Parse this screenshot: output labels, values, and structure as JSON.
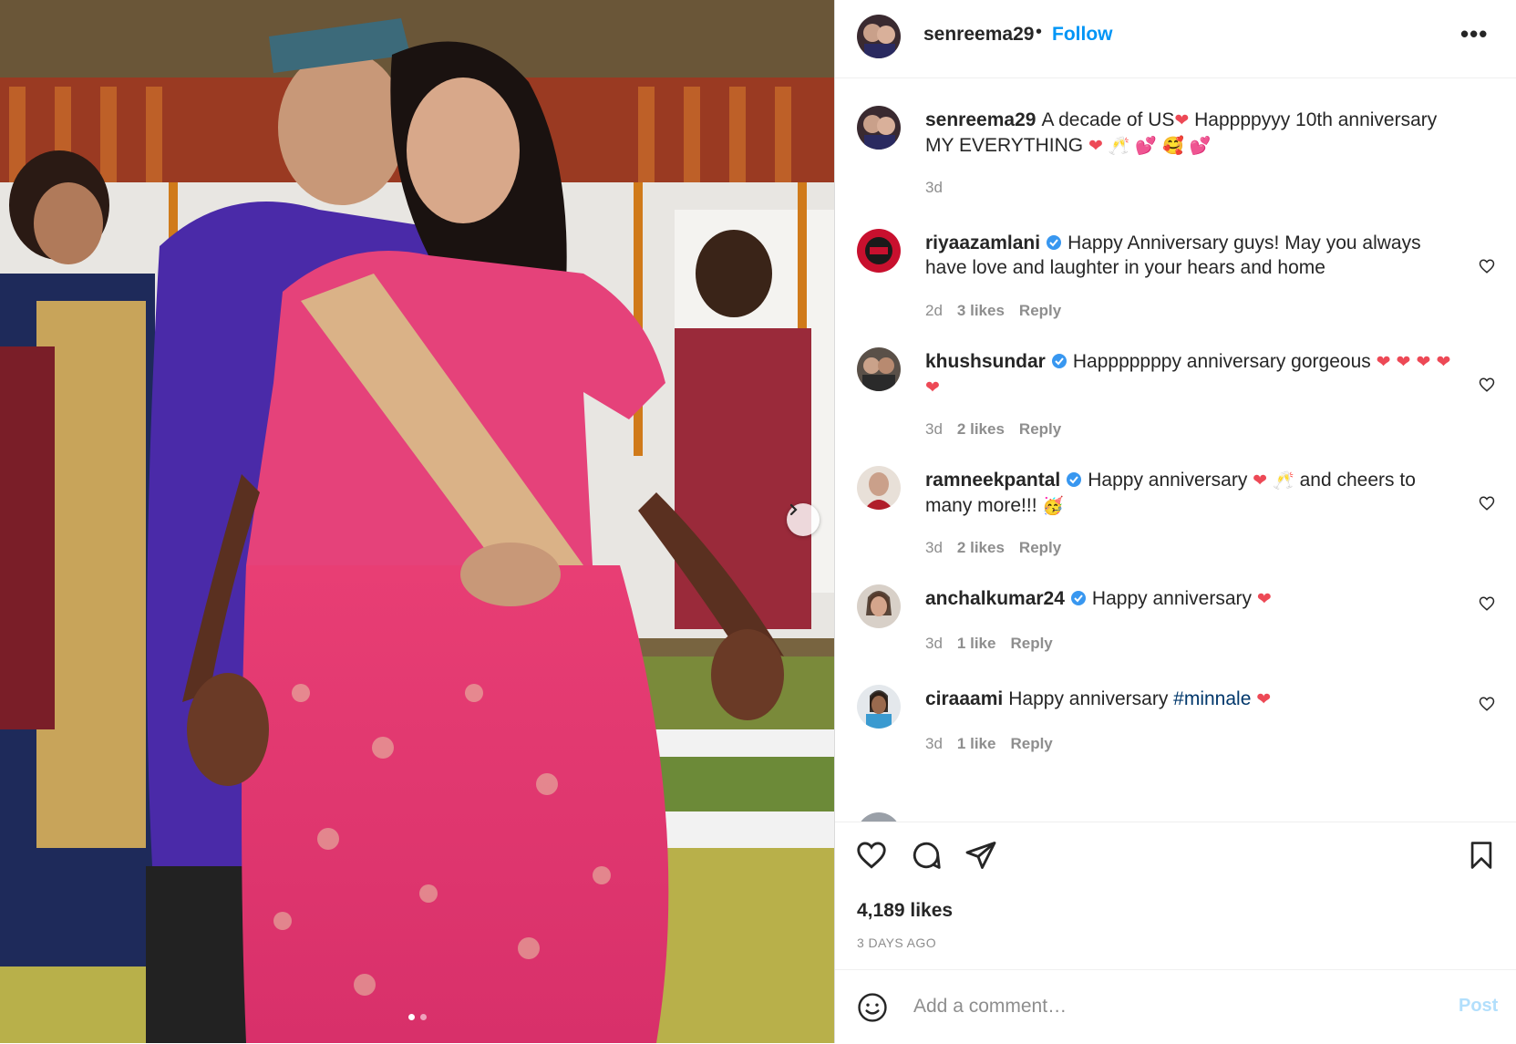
{
  "post": {
    "username": "senreema29",
    "follow_label": "Follow",
    "separator": "•",
    "more_label": "•••"
  },
  "caption": {
    "username": "senreema29",
    "text_a": "A decade of US",
    "text_b": " Happppyyy 10th anniversary MY EVERYTHING ",
    "emoji_heart": "❤",
    "emoji_rest": "🥂 💕 🥰 💕",
    "time": "3d"
  },
  "comments": [
    {
      "username": "riyaazamlani",
      "verified": true,
      "text": "Happy Anniversary guys! May you always have love and laughter in your hears and home",
      "emoji": "",
      "time": "2d",
      "likes": "3 likes",
      "reply": "Reply"
    },
    {
      "username": "khushsundar",
      "verified": true,
      "text": "Happpppppy anniversary gorgeous ",
      "emoji": "❤ ❤ ❤ ❤ ❤",
      "time": "3d",
      "likes": "2 likes",
      "reply": "Reply"
    },
    {
      "username": "ramneekpantal",
      "verified": true,
      "text": "Happy anniversary ",
      "emoji": "❤ 🥂",
      "text2": " and cheers to many more!!! ",
      "emoji2": "🥳",
      "time": "3d",
      "likes": "2 likes",
      "reply": "Reply"
    },
    {
      "username": "anchalkumar24",
      "verified": true,
      "text": "Happy anniversary ",
      "emoji": "❤",
      "time": "3d",
      "likes": "1 like",
      "reply": "Reply"
    },
    {
      "username": "ciraaami",
      "verified": false,
      "text": "Happy anniversary ",
      "hashtag": "#minnale",
      "emoji": "❤",
      "time": "3d",
      "likes": "1 like",
      "reply": "Reply"
    }
  ],
  "likes_count": "4,189 likes",
  "posted_ago": "3 DAYS AGO",
  "add_comment": {
    "placeholder": "Add a comment…",
    "post_label": "Post"
  },
  "colors": {
    "accent": "#0095f6",
    "heart": "#ed4956",
    "muted": "#8e8e8e"
  }
}
